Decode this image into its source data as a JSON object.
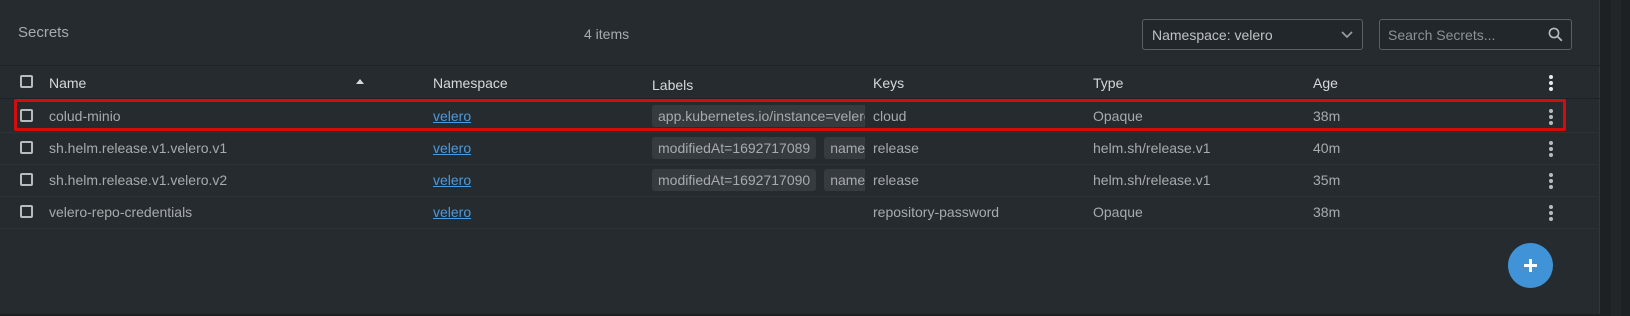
{
  "header": {
    "title": "Secrets",
    "count": "4 items",
    "namespace_select": "Namespace: velero",
    "search_placeholder": "Search Secrets..."
  },
  "columns": {
    "name": "Name",
    "namespace": "Namespace",
    "labels": "Labels",
    "keys": "Keys",
    "type": "Type",
    "age": "Age"
  },
  "rows": [
    {
      "name": "colud-minio",
      "namespace": "velero",
      "labels": [
        "app.kubernetes.io/instance=velero"
      ],
      "keys": "cloud",
      "type": "Opaque",
      "age": "38m",
      "highlighted": true
    },
    {
      "name": "sh.helm.release.v1.velero.v1",
      "namespace": "velero",
      "labels": [
        "modifiedAt=1692717089",
        "name=velero"
      ],
      "keys": "release",
      "type": "helm.sh/release.v1",
      "age": "40m"
    },
    {
      "name": "sh.helm.release.v1.velero.v2",
      "namespace": "velero",
      "labels": [
        "modifiedAt=1692717090",
        "name=velero"
      ],
      "keys": "release",
      "type": "helm.sh/release.v1",
      "age": "35m"
    },
    {
      "name": "velero-repo-credentials",
      "namespace": "velero",
      "labels": [],
      "keys": "repository-password",
      "type": "Opaque",
      "age": "38m"
    }
  ],
  "sort": {
    "column": "name",
    "direction": "ascending"
  },
  "icons": {
    "namespace_dropdown": "chevron-down-icon",
    "search": "search-icon",
    "sort": "sort-ascending-icon",
    "row_menu": "more-vertical-icon",
    "add": "plus-icon"
  },
  "colors": {
    "panel_background": "#262b2f",
    "link": "#4a9be0",
    "highlight_border": "#d10d0d",
    "add_button": "#3f93d6"
  }
}
